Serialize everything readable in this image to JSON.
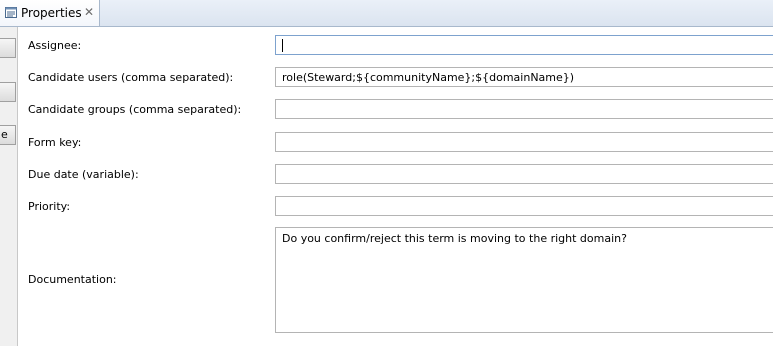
{
  "tab": {
    "title": "Properties",
    "icon": "properties-icon",
    "close_icon": "close-icon",
    "close_glyph": "✕"
  },
  "sidebar": {
    "buttons": [
      "",
      "",
      "e"
    ]
  },
  "form": {
    "assignee": {
      "label": "Assignee:",
      "value": ""
    },
    "candidate_users": {
      "label": "Candidate users (comma separated):",
      "value": "role(Steward;${communityName};${domainName})"
    },
    "candidate_groups": {
      "label": "Candidate groups (comma separated):",
      "value": ""
    },
    "form_key": {
      "label": "Form key:",
      "value": ""
    },
    "due_date": {
      "label": "Due date (variable):",
      "value": ""
    },
    "priority": {
      "label": "Priority:",
      "value": ""
    },
    "documentation": {
      "label": "Documentation:",
      "value": "Do you confirm/reject this term is moving to the right domain?"
    }
  },
  "colors": {
    "tab_border": "#a8b8cc",
    "field_border": "#b4b4b4",
    "focus_border": "#7da2ce"
  }
}
